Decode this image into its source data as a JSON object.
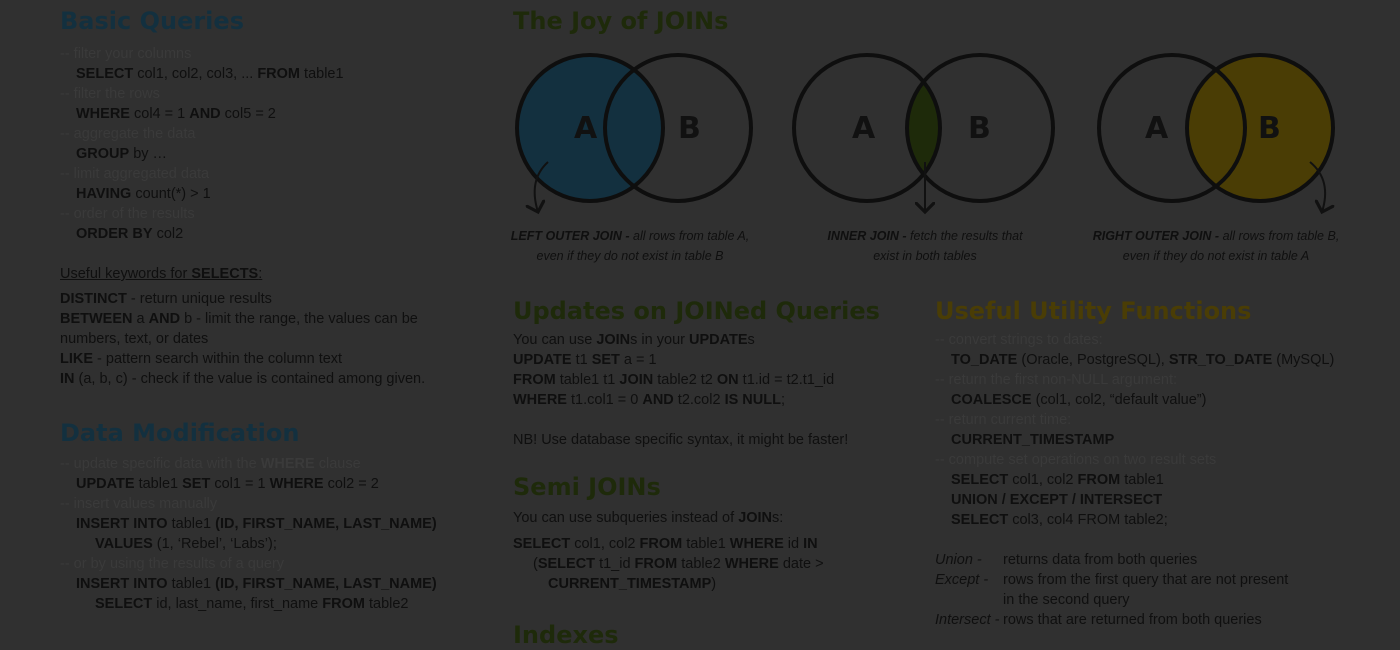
{
  "colors": {
    "bg": "#303030",
    "text": "#0f0f0f",
    "blue": "#13303f",
    "green": "#1e2a0a",
    "gold": "#4a3d05"
  },
  "basic": {
    "title": "Basic Queries",
    "lines": [
      {
        "cls": "cm",
        "html": "--  filter your columns"
      },
      {
        "cls": "i1",
        "html": "<b>SELECT</b> col1, col2, col3, ... <b>FROM</b> table1"
      },
      {
        "cls": "cm",
        "html": "--  filter the rows"
      },
      {
        "cls": "i1",
        "html": "<b>WHERE</b> col4 = 1 <b>AND</b> col5 = 2"
      },
      {
        "cls": "cm",
        "html": "-- aggregate the data"
      },
      {
        "cls": "i1",
        "html": "<b>GROUP</b> by …"
      },
      {
        "cls": "cm",
        "html": "-- limit aggregated data"
      },
      {
        "cls": "i1",
        "html": "<b>HAVING</b> count(*) &gt; 1"
      },
      {
        "cls": "cm",
        "html": "-- order of the results"
      },
      {
        "cls": "i1",
        "html": "<b>ORDER BY</b> col2"
      }
    ],
    "keywords_heading": "Useful keywords for <b>SELECTS</b>:",
    "keywords": [
      "<b>DISTINCT</b> - return unique results",
      "<b>BETWEEN</b> a <b>AND</b> b - limit the range, the values can be",
      "numbers, text, or dates",
      "<b>LIKE</b> - pattern search within the column text",
      "<b>IN</b> (a, b, c) - check if the value is contained among given."
    ]
  },
  "modification": {
    "title": "Data Modification",
    "lines": [
      {
        "cls": "cm",
        "html": "-- update specific data with the <b>WHERE</b> clause"
      },
      {
        "cls": "i1",
        "html": "<b>UPDATE</b> table1 <b>SET</b> col1 = 1 <b>WHERE</b> col2 = 2"
      },
      {
        "cls": "cm",
        "html": "-- insert values manually"
      },
      {
        "cls": "i1",
        "html": "<b>INSERT INTO</b> table1 <b>(ID, FIRST_NAME, LAST_NAME)</b>"
      },
      {
        "cls": "i2",
        "html": "<b>VALUES</b> (1, ‘Rebel’, ‘Labs’);"
      },
      {
        "cls": "cm",
        "html": "-- or by using the results of a query"
      },
      {
        "cls": "i1",
        "html": "<b>INSERT INTO</b> table1 <b>(ID, FIRST_NAME, LAST_NAME)</b>"
      },
      {
        "cls": "i2",
        "html": "<b>SELECT</b> id, last_name, first_name <b>FROM</b> table2"
      }
    ]
  },
  "joins": {
    "title": "The Joy of JOINs",
    "label_a": "A",
    "label_b": "B",
    "diagrams": [
      {
        "type": "left",
        "caption_bold": "LEFT OUTER JOIN -",
        "caption": " all rows from table A,",
        "caption2": "even if they do not exist in table B",
        "fill": "#13303f"
      },
      {
        "type": "inner",
        "caption_bold": "INNER JOIN -",
        "caption": " fetch the results that",
        "caption2": "exist in both tables",
        "fill": "#1e2a0a"
      },
      {
        "type": "right",
        "caption_bold": "RIGHT OUTER JOIN -",
        "caption": " all rows from table B,",
        "caption2": "even if they do not exist in table A",
        "fill": "#4a3d05"
      }
    ]
  },
  "updates": {
    "title": "Updates on JOINed Queries",
    "lines": [
      {
        "cls": "",
        "html": "You can use <b>JOIN</b>s in your <b>UPDATE</b>s"
      },
      {
        "cls": "",
        "html": "<b>UPDATE</b> t1 <b>SET</b> a = 1"
      },
      {
        "cls": "",
        "html": "<b>FROM</b> table1 t1 <b>JOIN</b> table2 t2 <b>ON</b> t1.id = t2.t1_id"
      },
      {
        "cls": "",
        "html": "<b>WHERE</b> t1.col1 = 0 <b>AND</b> t2.col2 <b>IS NULL</b>;"
      }
    ],
    "note": "NB! Use database specific syntax, it might be faster!"
  },
  "semi": {
    "title": "Semi JOINs",
    "intro": "You can use subqueries instead of <b>JOIN</b>s:",
    "lines": [
      {
        "cls": "",
        "html": "<b>SELECT</b> col1, col2 <b>FROM</b> table1 <b>WHERE</b> id <b>IN</b>"
      },
      {
        "cls": "i3",
        "html": "(<b>SELECT</b> t1_id <b>FROM</b> table2 <b>WHERE</b> date &gt;"
      },
      {
        "cls": "i2",
        "html": "<b>CURRENT_TIMESTAMP</b>)"
      }
    ]
  },
  "indexes": {
    "title": "Indexes"
  },
  "utility": {
    "title": "Useful Utility Functions",
    "lines": [
      {
        "cls": "cm",
        "html": "-- convert strings to dates:"
      },
      {
        "cls": "i1",
        "html": "<b>TO_DATE</b> (Oracle, PostgreSQL), <b>STR_TO_DATE</b> (MySQL)"
      },
      {
        "cls": "cm",
        "html": "-- return the first non-NULL argument:"
      },
      {
        "cls": "i1",
        "html": "<b>COALESCE</b> (col1, col2, “default value”)"
      },
      {
        "cls": "cm",
        "html": "-- return current time:"
      },
      {
        "cls": "i1",
        "html": "<b>CURRENT_TIMESTAMP</b>"
      },
      {
        "cls": "cm",
        "html": "-- compute set operations on two result sets"
      },
      {
        "cls": "i1",
        "html": "<b>SELECT</b> col1, col2 <b>FROM</b> table1"
      },
      {
        "cls": "i1",
        "html": "<b>UNION / EXCEPT / INTERSECT</b>"
      },
      {
        "cls": "i1",
        "html": "<b>SELECT</b> col3, col4 FROM table2;"
      }
    ],
    "legend": [
      {
        "k": "Union -",
        "v": "returns data from both queries"
      },
      {
        "k": "Except -",
        "v": "rows from the first query that are not present"
      },
      {
        "k": "",
        "v": "in the second query"
      },
      {
        "k": "Intersect -",
        "v": "rows that are returned from both queries"
      }
    ]
  }
}
